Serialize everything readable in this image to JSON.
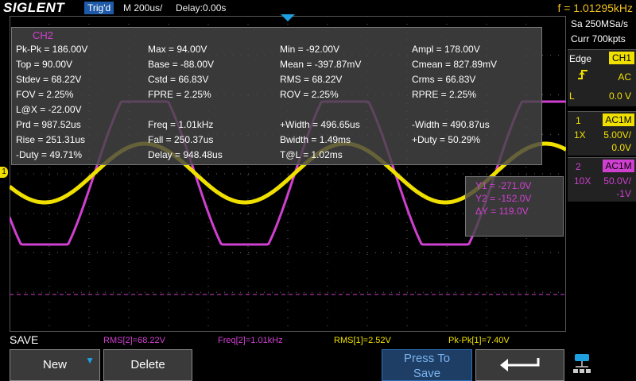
{
  "header": {
    "brand": "SIGLENT",
    "trigger_status": "Trig'd",
    "timebase": "M 200us/",
    "delay": "Delay:0.00s",
    "frequency": "f = 1.01295kHz"
  },
  "acquisition": {
    "sample_rate": "Sa 250MSa/s",
    "memory_depth": "Curr 700kpts"
  },
  "trigger": {
    "type": "Edge",
    "source": "CH1",
    "coupling": "AC",
    "level_label": "L",
    "level": "0.0 V",
    "slope_icon": "rising-edge-icon"
  },
  "channels": [
    {
      "number": "1",
      "coupling": "AC1M",
      "probe": "1X",
      "scale": "5.00V/",
      "offset": "0.0V",
      "color": "#f0e000"
    },
    {
      "number": "2",
      "coupling": "AC1M",
      "probe": "10X",
      "scale": "50.0V/",
      "offset": "-1V",
      "color": "#d040d0"
    }
  ],
  "ch1_marker": "1",
  "measurements": {
    "title": "CH2",
    "items": [
      "Pk-Pk = 186.00V",
      "Max = 94.00V",
      "Min = -92.00V",
      "Ampl = 178.00V",
      "Top = 90.00V",
      "Base = -88.00V",
      "Mean = -397.87mV",
      "Cmean = 827.89mV",
      "Stdev = 68.22V",
      "Cstd = 66.83V",
      "RMS = 68.22V",
      "Crms = 66.83V",
      "FOV = 2.25%",
      "FPRE = 2.25%",
      "ROV = 2.25%",
      "RPRE = 2.25%",
      "L@X = -22.00V",
      "Prd = 987.52us",
      "Freq = 1.01kHz",
      "+Width = 496.65us",
      "-Width = 490.87us",
      "Rise = 251.31us",
      "Fall = 250.37us",
      "Bwidth = 1.49ms",
      "+Duty = 50.29%",
      "-Duty = 49.71%",
      "Delay = 948.48us",
      "T@L = 1.02ms"
    ]
  },
  "cursors": {
    "y1": "Y1 = -271.0V",
    "y2": "Y2 = -152.0V",
    "dy": "ΔY = 119.0V"
  },
  "quick_measure": [
    {
      "text": "RMS[2]=68.22V",
      "color": "#d040d0"
    },
    {
      "text": "Freq[2]=1.01kHz",
      "color": "#d040d0"
    },
    {
      "text": "RMS[1]=2.52V",
      "color": "#f0e000"
    },
    {
      "text": "Pk-Pk[1]=7.40V",
      "color": "#f0e000"
    }
  ],
  "menu": {
    "title": "SAVE",
    "softkeys": {
      "new": "New",
      "delete": "Delete",
      "press_to_save_line1": "Press To",
      "press_to_save_line2": "Save",
      "back_icon": "return-arrow-icon"
    }
  },
  "status_icons": [
    "lan-icon"
  ]
}
